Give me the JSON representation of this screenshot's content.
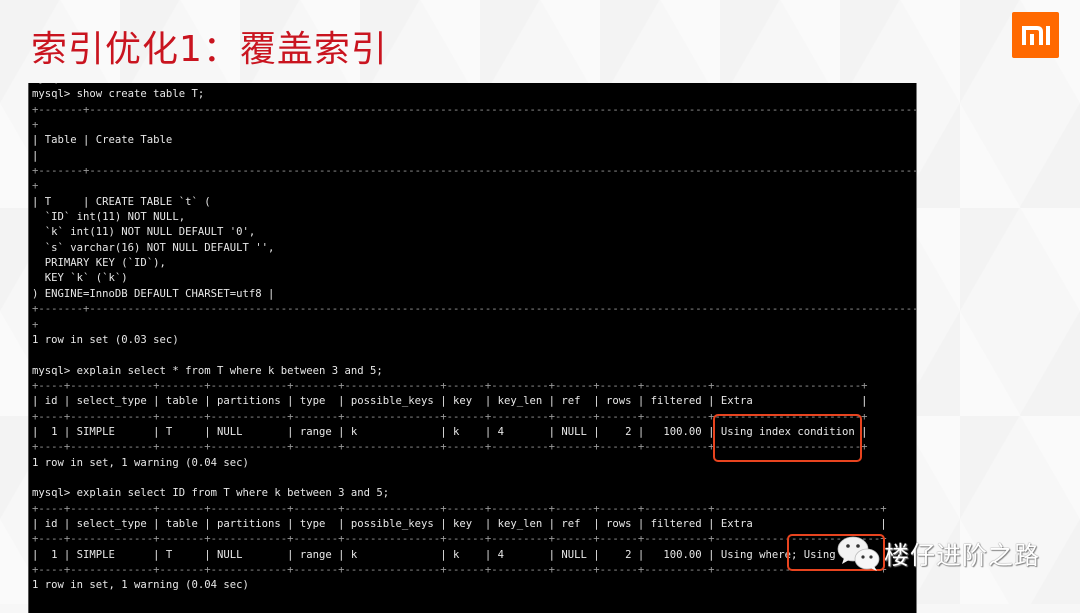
{
  "slide": {
    "title": "索引优化1：覆盖索引",
    "logo_icon": "mi-logo-icon",
    "accent_color": "#c9141f",
    "logo_color": "#ff6900",
    "highlight_color": "#e8441f"
  },
  "terminal": {
    "lines": [
      {
        "text": "mysql>",
        "kind": "faded"
      },
      {
        "text": "mysql> show create table T;",
        "kind": "text"
      },
      {
        "text": "+-------+--------------------------------------------------------------------------------------------------------------------------------------",
        "kind": "sep"
      },
      {
        "text": "+",
        "kind": "sep"
      },
      {
        "text": "| Table | Create Table",
        "kind": "text"
      },
      {
        "text": "|",
        "kind": "text"
      },
      {
        "text": "+-------+--------------------------------------------------------------------------------------------------------------------------------------",
        "kind": "sep"
      },
      {
        "text": "+",
        "kind": "sep"
      },
      {
        "text": "| T     | CREATE TABLE `t` (",
        "kind": "text"
      },
      {
        "text": "  `ID` int(11) NOT NULL,",
        "kind": "text"
      },
      {
        "text": "  `k` int(11) NOT NULL DEFAULT '0',",
        "kind": "text"
      },
      {
        "text": "  `s` varchar(16) NOT NULL DEFAULT '',",
        "kind": "text"
      },
      {
        "text": "  PRIMARY KEY (`ID`),",
        "kind": "text"
      },
      {
        "text": "  KEY `k` (`k`)",
        "kind": "text"
      },
      {
        "text": ") ENGINE=InnoDB DEFAULT CHARSET=utf8 |",
        "kind": "text"
      },
      {
        "text": "+-------+--------------------------------------------------------------------------------------------------------------------------------------",
        "kind": "sep"
      },
      {
        "text": "+",
        "kind": "sep"
      },
      {
        "text": "1 row in set (0.03 sec)",
        "kind": "text"
      },
      {
        "text": "",
        "kind": "text"
      },
      {
        "text": "mysql> explain select * from T where k between 3 and 5;",
        "kind": "text"
      },
      {
        "text": "+----+-------------+-------+------------+-------+---------------+------+---------+------+------+----------+-----------------------+",
        "kind": "sep"
      },
      {
        "text": "| id | select_type | table | partitions | type  | possible_keys | key  | key_len | ref  | rows | filtered | Extra                 |",
        "kind": "text"
      },
      {
        "text": "+----+-------------+-------+------------+-------+---------------+------+---------+------+------+----------+-----------------------+",
        "kind": "sep"
      },
      {
        "text": "|  1 | SIMPLE      | T     | NULL       | range | k             | k    | 4       | NULL |    2 |   100.00 | Using index condition |",
        "kind": "text"
      },
      {
        "text": "+----+-------------+-------+------------+-------+---------------+------+---------+------+------+----------+-----------------------+",
        "kind": "sep"
      },
      {
        "text": "1 row in set, 1 warning (0.04 sec)",
        "kind": "text"
      },
      {
        "text": "",
        "kind": "text"
      },
      {
        "text": "mysql> explain select ID from T where k between 3 and 5;",
        "kind": "text"
      },
      {
        "text": "+----+-------------+-------+------------+-------+---------------+------+---------+------+------+----------+--------------------------+",
        "kind": "sep"
      },
      {
        "text": "| id | select_type | table | partitions | type  | possible_keys | key  | key_len | ref  | rows | filtered | Extra                    |",
        "kind": "text"
      },
      {
        "text": "+----+-------------+-------+------------+-------+---------------+------+---------+------+------+----------+--------------------------+",
        "kind": "sep"
      },
      {
        "text": "|  1 | SIMPLE      | T     | NULL       | range | k             | k    | 4       | NULL |    2 |   100.00 | Using where; Using index |",
        "kind": "text"
      },
      {
        "text": "+----+-------------+-------+------------+-------+---------------+------+---------+------+------+----------+--------------------------+",
        "kind": "sep"
      },
      {
        "text": "1 row in set, 1 warning (0.04 sec)",
        "kind": "text"
      }
    ],
    "queries": [
      {
        "command": "show create table T;",
        "result_summary": "1 row in set (0.03 sec)"
      },
      {
        "command": "explain select * from T where k between 3 and 5;",
        "columns": [
          "id",
          "select_type",
          "table",
          "partitions",
          "type",
          "possible_keys",
          "key",
          "key_len",
          "ref",
          "rows",
          "filtered",
          "Extra"
        ],
        "rows": [
          [
            "1",
            "SIMPLE",
            "T",
            "NULL",
            "range",
            "k",
            "k",
            "4",
            "NULL",
            "2",
            "100.00",
            "Using index condition"
          ]
        ],
        "result_summary": "1 row in set, 1 warning (0.04 sec)",
        "highlighted": "Using index condition"
      },
      {
        "command": "explain select ID from T where k between 3 and 5;",
        "columns": [
          "id",
          "select_type",
          "table",
          "partitions",
          "type",
          "possible_keys",
          "key",
          "key_len",
          "ref",
          "rows",
          "filtered",
          "Extra"
        ],
        "rows": [
          [
            "1",
            "SIMPLE",
            "T",
            "NULL",
            "range",
            "k",
            "k",
            "4",
            "NULL",
            "2",
            "100.00",
            "Using where; Using index"
          ]
        ],
        "result_summary": "1 row in set, 1 warning (0.04 sec)",
        "highlighted": "Using index"
      }
    ]
  },
  "watermark": {
    "icon": "wechat-icon",
    "text": "楼仔进阶之路"
  }
}
